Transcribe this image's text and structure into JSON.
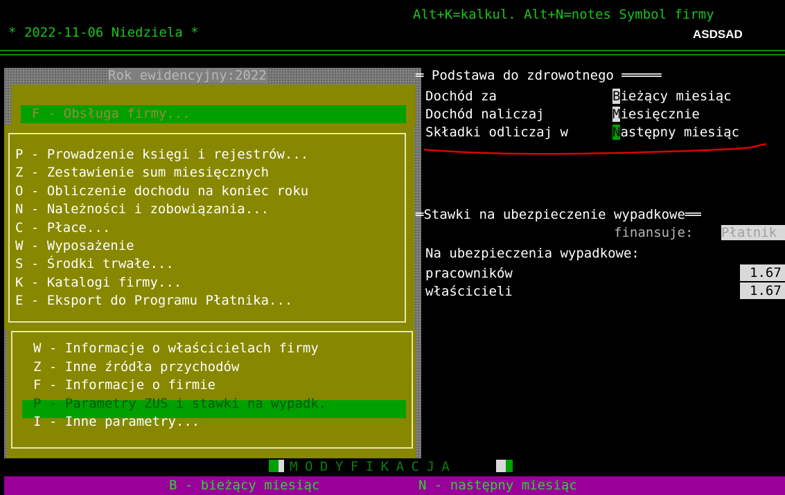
{
  "header": {
    "date": "* 2022-11-06 Niedziela *",
    "shortcuts": "Alt+K=kalkul. Alt+N=notes Symbol firmy",
    "company_symbol": "ASDSAD"
  },
  "year_title": "Rok ewidencyjny:2022",
  "main_menu": {
    "top_item": "F - Obsługa firmy...",
    "items": [
      "P - Prowadzenie księgi i rejestrów...",
      "Z - Zestawienie sum miesięcznych",
      "O - Obliczenie dochodu na koniec roku",
      "N - Należności i zobowiązania...",
      "C - Płace...",
      "W - Wyposażenie",
      "S - Środki trwałe...",
      "K - Katalogi firmy...",
      "E - Eksport do Programu Płatnika..."
    ]
  },
  "sub_menu": {
    "items": [
      "W - Informacje o właścicielach firmy",
      "Z - Inne źródła przychodów",
      "F - Informacje o firmie",
      "P - Parametry ZUS i stawki na wypadk.",
      "I - Inne parametry..."
    ],
    "selected_index": 3
  },
  "health_section": {
    "title": "Podstawa do zdrowotnego",
    "rows": [
      {
        "label": "Dochód za",
        "first": "B",
        "rest": "ieżący miesiąc"
      },
      {
        "label": "Dochód naliczaj",
        "first": "M",
        "rest": "iesięcznie"
      },
      {
        "label": "Składki odliczaj w",
        "first": "N",
        "rest": "astępny miesiąc"
      }
    ]
  },
  "accident_section": {
    "title": "Stawki na ubezpieczenie wypadkowe",
    "financed_label": "finansuje:",
    "financed_value": "Płatnik",
    "subtitle": "Na ubezpieczenia wypadkowe:",
    "rows": [
      {
        "label": "pracowników",
        "value": "1.67"
      },
      {
        "label": "właścicieli",
        "value": "1.67"
      }
    ]
  },
  "mode_label": "MODYFIKACJA",
  "bottom_bar": {
    "option1": "B - bieżący miesiąc",
    "option2": "N - następny miesiąc"
  },
  "colors": {
    "header_green": "#1cc31c",
    "menu_olive": "#878700",
    "highlight_green": "#00a000",
    "bottom_magenta": "#990099"
  }
}
